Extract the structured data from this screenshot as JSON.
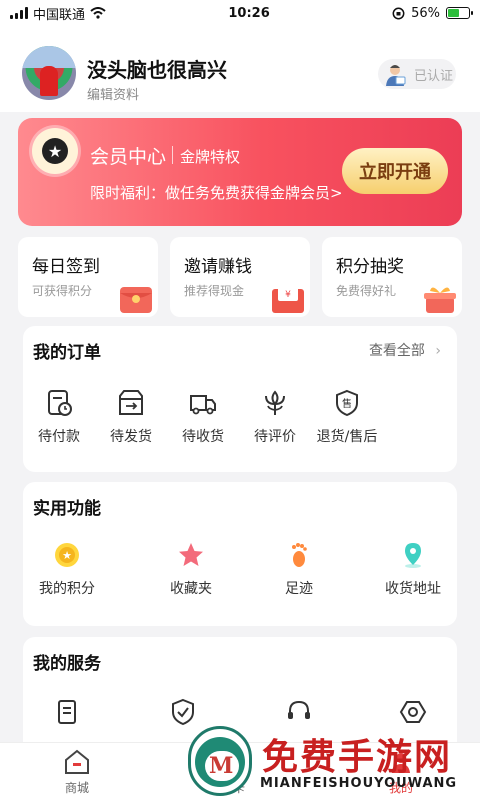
{
  "status_bar": {
    "carrier": "中国联通",
    "time": "10:26",
    "battery": "56%",
    "battery_level": 0.56
  },
  "profile": {
    "nickname": "没头脑也很高兴",
    "edit_label": "编辑资料",
    "verified_label": "已认证"
  },
  "vip_banner": {
    "title": "会员中心",
    "subtitle": "金牌特权",
    "promo": "限时福利：做任务免费获得金牌会员>",
    "button": "立即开通",
    "colors": {
      "start": "#ff8a8f",
      "end": "#ec3d55",
      "button": "#f6cf6e"
    }
  },
  "quick_actions": [
    {
      "title": "每日签到",
      "subtitle": "可获得积分",
      "icon": "red-envelope-icon"
    },
    {
      "title": "邀请赚钱",
      "subtitle": "推荐得现金",
      "icon": "cash-envelope-icon"
    },
    {
      "title": "积分抽奖",
      "subtitle": "免费得好礼",
      "icon": "gift-box-icon"
    }
  ],
  "orders": {
    "title": "我的订单",
    "view_all": "查看全部",
    "items": [
      {
        "label": "待付款",
        "icon": "pending-payment-icon"
      },
      {
        "label": "待发货",
        "icon": "pending-shipment-icon"
      },
      {
        "label": "待收货",
        "icon": "truck-icon"
      },
      {
        "label": "待评价",
        "icon": "flower-review-icon"
      },
      {
        "label": "退货/售后",
        "icon": "after-sales-shield-icon"
      }
    ]
  },
  "features": {
    "title": "实用功能",
    "items": [
      {
        "label": "我的积分",
        "icon": "points-coin-icon"
      },
      {
        "label": "收藏夹",
        "icon": "star-icon"
      },
      {
        "label": "足迹",
        "icon": "footprint-icon"
      },
      {
        "label": "收货地址",
        "icon": "location-pin-icon"
      }
    ]
  },
  "services": {
    "title": "我的服务",
    "items": [
      {
        "icon": "document-icon"
      },
      {
        "icon": "shield-check-icon"
      },
      {
        "icon": "headset-icon"
      },
      {
        "icon": "settings-hex-icon"
      }
    ]
  },
  "tab_bar": {
    "tabs": [
      {
        "label": "商城",
        "icon": "home-icon"
      },
      {
        "label": "卡",
        "icon": "card-icon"
      },
      {
        "label": "我的",
        "icon": "user-icon"
      }
    ]
  },
  "watermark": {
    "text": "免费手游网",
    "sub": "MIANFEISHOUYOUWANG",
    "colors": {
      "text": "#c82020",
      "logo": "#1f8a75"
    }
  }
}
